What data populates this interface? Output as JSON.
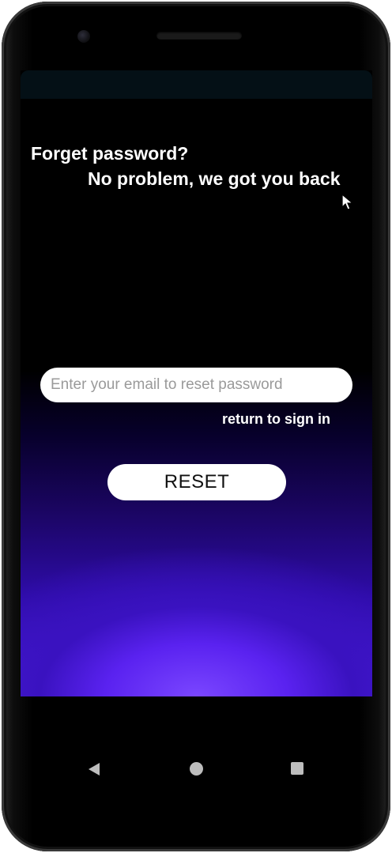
{
  "header": {
    "title": "Forget password?",
    "subtitle": "No problem, we got you back"
  },
  "form": {
    "email_placeholder": "Enter your email to reset password",
    "email_value": "",
    "return_link_label": "return to sign in",
    "reset_button_label": "RESET"
  },
  "navigation": {
    "back_icon": "back-triangle-icon",
    "home_icon": "home-circle-icon",
    "recents_icon": "recents-square-icon"
  },
  "colors": {
    "background_top": "#000000",
    "gradient_glow": "#7a46ff",
    "text": "#ffffff",
    "input_background": "#ffffff"
  }
}
